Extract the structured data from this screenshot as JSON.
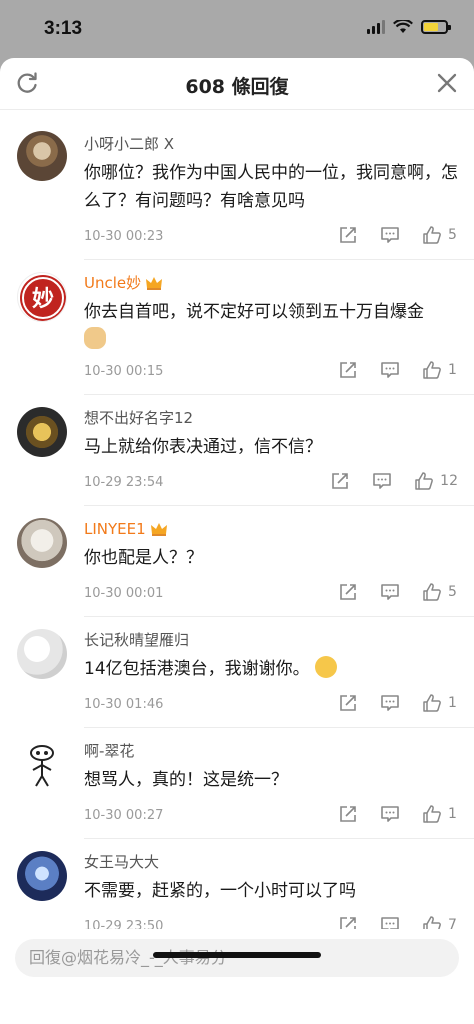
{
  "status": {
    "time": "3:13"
  },
  "header": {
    "title": "608 條回復"
  },
  "comments": [
    {
      "name": "小呀小二郎 X",
      "vip": false,
      "text": "你哪位？我作为中国人民中的一位，我同意啊，怎么了？有问题吗？有啥意见吗",
      "time": "10-30 00:23",
      "likes": "5"
    },
    {
      "name": "Uncle妙",
      "vip": true,
      "text": "你去自首吧，说不定好可以领到五十万自爆金",
      "time": "10-30 00:15",
      "likes": "1"
    },
    {
      "name": "想不出好名字12",
      "vip": false,
      "text": "马上就给你表决通过，信不信？",
      "time": "10-29 23:54",
      "likes": "12"
    },
    {
      "name": "LINYEE1",
      "vip": true,
      "text": "你也配是人？？",
      "time": "10-30 00:01",
      "likes": "5"
    },
    {
      "name": "长记秋晴望雁归",
      "vip": false,
      "text": "14亿包括港澳台，我谢谢你。",
      "time": "10-30 01:46",
      "likes": "1"
    },
    {
      "name": "啊-翠花",
      "vip": false,
      "text": "想骂人，真的！这是统一？",
      "time": "10-30 00:27",
      "likes": "1"
    },
    {
      "name": "女王马大大",
      "vip": false,
      "text": "不需要，赶紧的，一个小时可以了吗",
      "time": "10-29 23:50",
      "likes": "7"
    }
  ],
  "reply": {
    "placeholder": "回復@烟花易冷_-_人事易分"
  },
  "icons": {
    "refresh": "refresh-icon",
    "close": "close-icon",
    "share": "share-icon",
    "comment": "comment-icon",
    "like": "thumbs-up-icon"
  },
  "colors": {
    "vip_name": "#f27a1a",
    "muted": "#9a9a9a",
    "overlay": "#a9a9a9"
  }
}
